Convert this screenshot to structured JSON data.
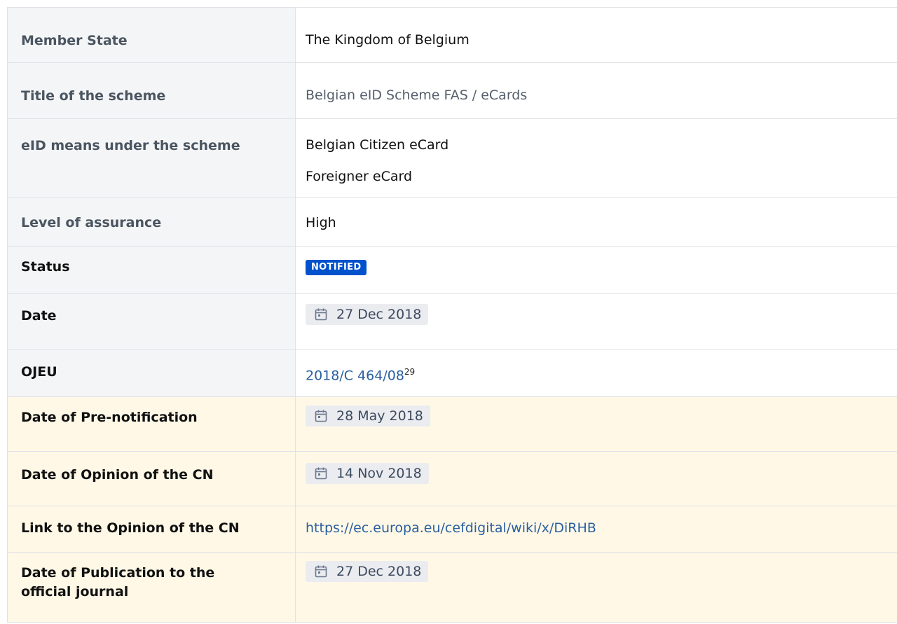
{
  "rows": [
    {
      "label": "Member State",
      "value": "The Kingdom of Belgium"
    },
    {
      "label": "Title of the scheme",
      "value": "Belgian eID Scheme FAS / eCards"
    },
    {
      "label": "eID means under the scheme",
      "values": [
        "Belgian Citizen eCard",
        "Foreigner eCard"
      ]
    },
    {
      "label": "Level of assurance",
      "value": "High"
    },
    {
      "label": "Status",
      "badge": "NOTIFIED"
    },
    {
      "label": "Date",
      "date": "27 Dec 2018"
    },
    {
      "label": "OJEU",
      "link": "2018/C 464/08",
      "footnote": "29"
    },
    {
      "label": "Date of Pre-notification",
      "date": "28 May 2018"
    },
    {
      "label": "Date of Opinion of the CN",
      "date": "14 Nov 2018"
    },
    {
      "label": "Link to the Opinion of the CN",
      "link": "https://ec.europa.eu/cefdigital/wiki/x/DiRHB"
    },
    {
      "label": "Date of Publication to the official journal",
      "date": "27 Dec 2018"
    }
  ],
  "icons": {
    "date": "calendar-icon"
  },
  "colors": {
    "badge": "#0052cc",
    "highlight_row": "#fff8e6",
    "label_cell": "#f4f5f7",
    "link": "#2a5fa0"
  }
}
